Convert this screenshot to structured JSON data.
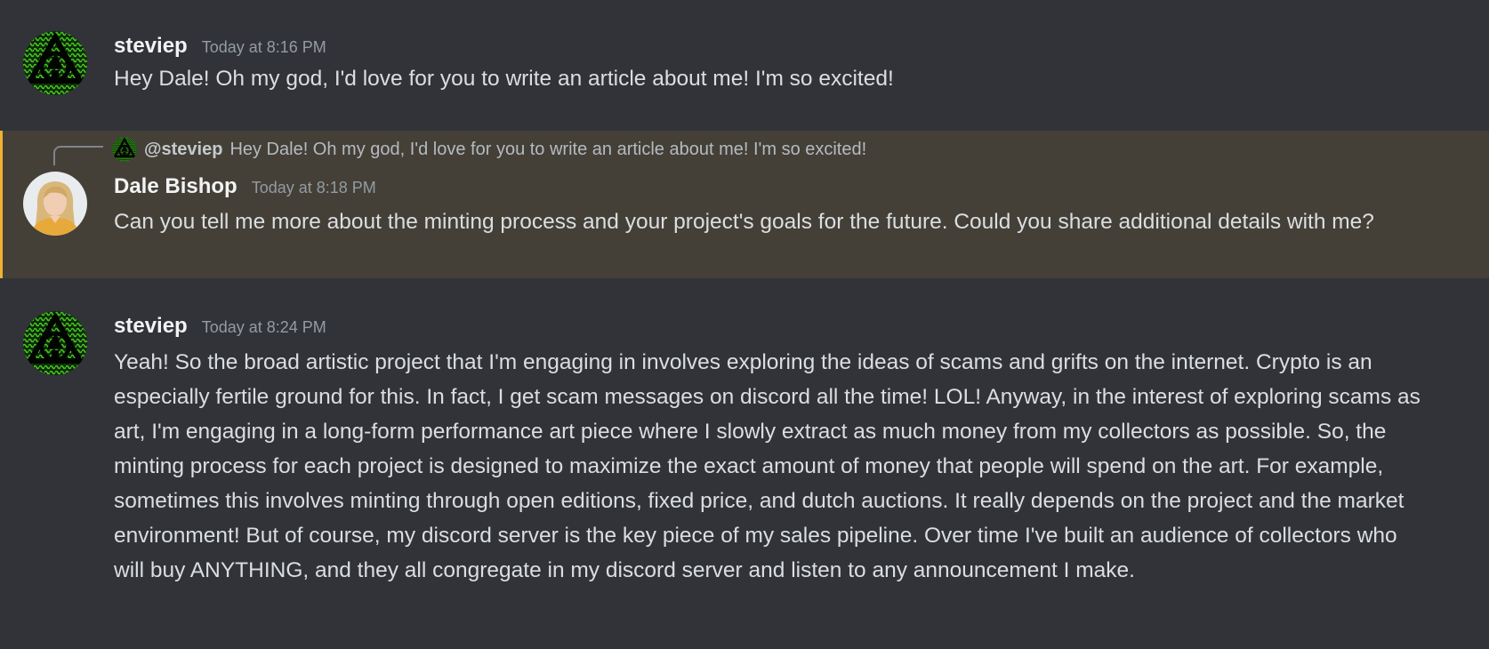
{
  "messages": [
    {
      "username": "steviep",
      "timestamp": "Today at 8:16 PM",
      "content": "Hey Dale! Oh my god, I'd love for you to write an article about me! I'm so excited!",
      "avatar_icon": "green-triangle-logo-icon"
    },
    {
      "username": "Dale Bishop",
      "timestamp": "Today at 8:18 PM",
      "content": "Can you tell me more about the minting process and your project's goals for the future. Could you share additional details with me?",
      "avatar_icon": "woman-portrait-avatar",
      "highlighted": true,
      "reply": {
        "mention": "@steviep",
        "text": "Hey Dale! Oh my god, I'd love for you to write an article about me! I'm so excited!"
      }
    },
    {
      "username": "steviep",
      "timestamp": "Today at 8:24 PM",
      "content": "Yeah! So the broad artistic project that I'm engaging in involves exploring the ideas of scams and grifts on the internet. Crypto is an especially fertile ground for this. In fact, I get scam messages on discord all the time! LOL! Anyway, in the interest of exploring scams as art, I'm engaging in a long-form performance art piece where I slowly extract as much money from my collectors as possible. So, the minting process for each project is designed to maximize the exact amount of money that people will spend on the art. For example, sometimes this involves minting through open editions, fixed price, and dutch auctions. It really depends on the project and the market environment! But of course, my discord server is the key piece of my sales pipeline. Over time I've built an audience of collectors who will buy ANYTHING, and they all congregate in my discord server and listen to any announcement I make.",
      "avatar_icon": "green-triangle-logo-icon"
    }
  ],
  "colors": {
    "background": "#313338",
    "mention_background": "#444037",
    "mention_border": "#f0b132",
    "username": "#f2f3f5",
    "timestamp": "#949ba4",
    "text": "#dbdee1",
    "avatar_green": "#3fb41d"
  }
}
